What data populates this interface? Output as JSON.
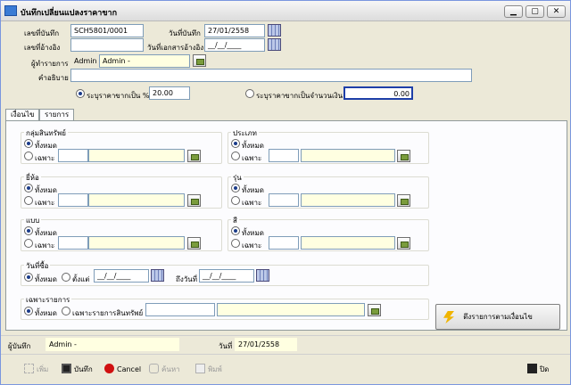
{
  "window": {
    "title": "บันทึกเปลี่ยนแปลงราคาขาก",
    "min": "▁",
    "max": "▢",
    "close": "✕"
  },
  "header": {
    "doc_no_label": "เลขที่บันทึก",
    "doc_no": "SCH5801/0001",
    "date_label": "วันที่บันทึก",
    "date": "27/01/2558",
    "ref_no_label": "เลขที่อ้างอิง",
    "ref_no": "",
    "ref_date_label": "วันที่เอกสารอ้างอิง",
    "ref_date": "__/__/____",
    "user_label": "ผู้ทำรายการ",
    "user_code": "Admin",
    "user_name": "Admin -",
    "desc_label": "คำอธิบาย",
    "desc": ""
  },
  "price": {
    "pct_label": "ระบุราคาขากเป็น %",
    "pct_value": "20.00",
    "amt_label": "ระบุราคาขากเป็นจำนวนเงิน",
    "amt_value": "0.00"
  },
  "tabs": [
    {
      "label": "เงื่อนไข"
    },
    {
      "label": "รายการ"
    }
  ],
  "filters": {
    "all": "ทั้งหมด",
    "only": "เฉพาะ",
    "group_label": "กลุ่มสินทรัพย์",
    "type_label": "ประเภท",
    "brand_label": "ยี่ห้อ",
    "model_label": "รุ่น",
    "style_label": "แบบ",
    "color_label": "สี",
    "buydate_label": "วันที่ซื้อ",
    "from_label": "ตั้งแต่",
    "from_date": "__/__/____",
    "to_label": "ถึงวันที่",
    "to_date": "__/__/____",
    "items_label": "เฉพาะรายการ",
    "items_only": "เฉพาะรายการสินทรัพย์"
  },
  "action_button": "ดึงรายการตามเงื่อนไข",
  "footer": {
    "recorder_label": "ผู้บันทึก",
    "recorder": "Admin -",
    "date_label": "วันที่",
    "date": "27/01/2558"
  },
  "toolbar": {
    "add": "เพิ่ม",
    "save": "บันทึก",
    "cancel": "Cancel",
    "search": "ค้นหา",
    "print": "พิมพ์",
    "close": "ปิด"
  }
}
